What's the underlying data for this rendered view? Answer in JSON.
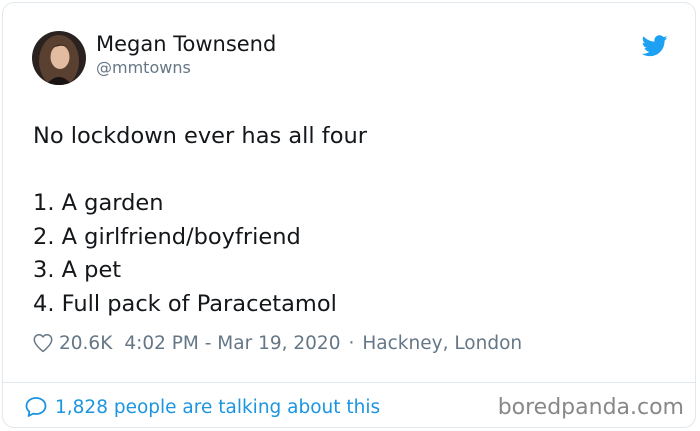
{
  "author": {
    "display_name": "Megan Townsend",
    "handle": "@mmtowns",
    "avatar_icon": "user-avatar-photo"
  },
  "brand": {
    "icon": "twitter-bird-icon",
    "color": "#1da1f2"
  },
  "tweet": {
    "lines": [
      "No lockdown ever has all four",
      "",
      "1. A garden",
      "2. A girlfriend/boyfriend",
      "3. A pet",
      "4. Full pack of Paracetamol"
    ]
  },
  "meta": {
    "like_count": "20.6K",
    "timestamp": "4:02 PM - Mar 19, 2020",
    "separator": "·",
    "location": "Hackney, London"
  },
  "footer": {
    "talking_text": "1,828 people are talking about this",
    "link_color": "#1b95e0"
  },
  "watermark": "boredpanda.com"
}
